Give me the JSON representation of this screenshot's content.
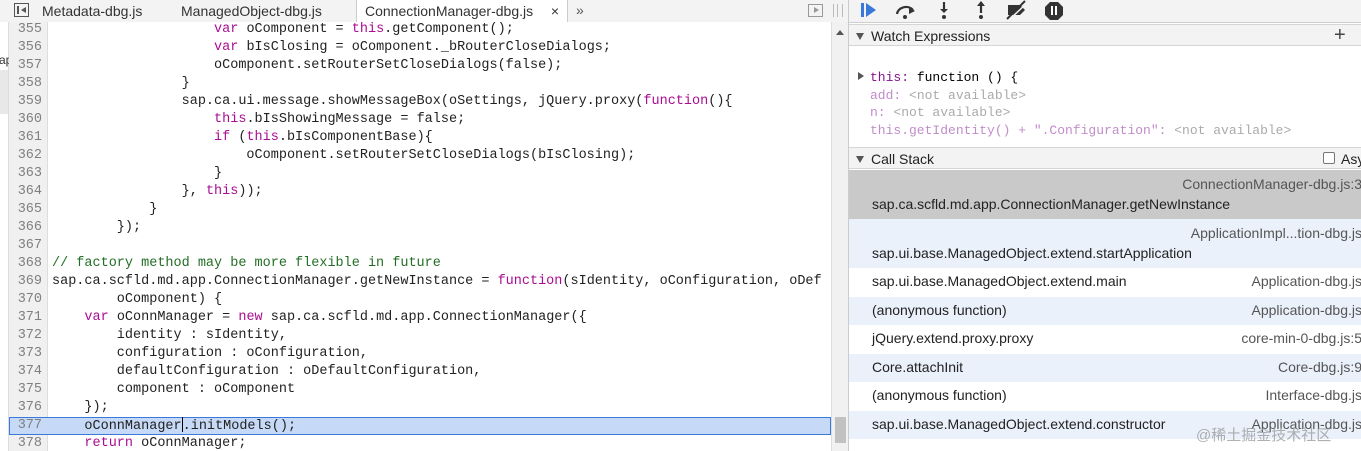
{
  "tabs": [
    {
      "label": "Metadata-dbg.js"
    },
    {
      "label": "ManagedObject-dbg.js"
    },
    {
      "label": "ConnectionManager-dbg.js",
      "close": "×"
    }
  ],
  "tab_overflow": "»",
  "left_strip_text": "ap",
  "code_lines": [
    {
      "n": "355",
      "parts": [
        [
          "",
          "                    "
        ],
        [
          "kw",
          "var"
        ],
        [
          "",
          " oComponent = "
        ],
        [
          "kw",
          "this"
        ],
        [
          "",
          ".getComponent();"
        ]
      ]
    },
    {
      "n": "356",
      "parts": [
        [
          "",
          "                    "
        ],
        [
          "kw",
          "var"
        ],
        [
          "",
          " bIsClosing = oComponent._bRouterCloseDialogs;"
        ]
      ]
    },
    {
      "n": "357",
      "parts": [
        [
          "",
          "                    oComponent.setRouterSetCloseDialogs(false);"
        ]
      ]
    },
    {
      "n": "358",
      "parts": [
        [
          "",
          "                }"
        ]
      ]
    },
    {
      "n": "359",
      "parts": [
        [
          "",
          "                sap.ca.ui.message.showMessageBox(oSettings, jQuery.proxy("
        ],
        [
          "kw",
          "function"
        ],
        [
          "",
          "(){"
        ]
      ]
    },
    {
      "n": "360",
      "parts": [
        [
          "",
          "                    "
        ],
        [
          "kw",
          "this"
        ],
        [
          "",
          ".bIsShowingMessage = false;"
        ]
      ]
    },
    {
      "n": "361",
      "parts": [
        [
          "",
          "                    "
        ],
        [
          "kw",
          "if"
        ],
        [
          "",
          " ("
        ],
        [
          "kw",
          "this"
        ],
        [
          "",
          ".bIsComponentBase){"
        ]
      ]
    },
    {
      "n": "362",
      "parts": [
        [
          "",
          "                        oComponent.setRouterSetCloseDialogs(bIsClosing);"
        ]
      ]
    },
    {
      "n": "363",
      "parts": [
        [
          "",
          "                    }"
        ]
      ]
    },
    {
      "n": "364",
      "parts": [
        [
          "",
          "                }, "
        ],
        [
          "kw",
          "this"
        ],
        [
          "",
          "));"
        ]
      ]
    },
    {
      "n": "365",
      "parts": [
        [
          "",
          "            }"
        ]
      ]
    },
    {
      "n": "366",
      "parts": [
        [
          "",
          "        });"
        ]
      ]
    },
    {
      "n": "367",
      "parts": [
        [
          "",
          ""
        ]
      ]
    },
    {
      "n": "368",
      "parts": [
        [
          "cm",
          "// factory method may be more flexible in future"
        ]
      ]
    },
    {
      "n": "369",
      "parts": [
        [
          "",
          "sap.ca.scfld.md.app.ConnectionManager.getNewInstance = "
        ],
        [
          "kw",
          "function"
        ],
        [
          "",
          "(sIdentity, oConfiguration, oDef"
        ]
      ]
    },
    {
      "n": "370",
      "parts": [
        [
          "",
          "        oComponent) {"
        ]
      ]
    },
    {
      "n": "371",
      "parts": [
        [
          "",
          "    "
        ],
        [
          "kw",
          "var"
        ],
        [
          "",
          " oConnManager = "
        ],
        [
          "kw",
          "new"
        ],
        [
          "",
          " sap.ca.scfld.md.app.ConnectionManager({"
        ]
      ]
    },
    {
      "n": "372",
      "parts": [
        [
          "",
          "        identity : sIdentity,"
        ]
      ]
    },
    {
      "n": "373",
      "parts": [
        [
          "",
          "        configuration : oConfiguration,"
        ]
      ]
    },
    {
      "n": "374",
      "parts": [
        [
          "",
          "        defaultConfiguration : oDefaultConfiguration,"
        ]
      ]
    },
    {
      "n": "375",
      "parts": [
        [
          "",
          "        component : oComponent"
        ]
      ]
    },
    {
      "n": "376",
      "parts": [
        [
          "",
          "    });"
        ]
      ]
    },
    {
      "n": "377",
      "hl": true,
      "parts": [
        [
          "",
          "    oConnManager"
        ],
        [
          "caret",
          ""
        ],
        [
          "",
          ".initModels();"
        ]
      ]
    },
    {
      "n": "378",
      "parts": [
        [
          "",
          "    "
        ],
        [
          "kw",
          "return"
        ],
        [
          "",
          " oConnManager;"
        ]
      ]
    }
  ],
  "watch": {
    "header": "Watch Expressions",
    "add": "+",
    "root_name": "this:",
    "root_value": " function () {",
    "props": [
      {
        "name": "add:",
        "value": " <not available>"
      },
      {
        "name": "n:",
        "value": " <not available>"
      },
      {
        "name": "this.getIdentity() + \".Configuration\":",
        "value": " <not available>"
      }
    ]
  },
  "callstack": {
    "header": "Call Stack",
    "async_label": "Asy",
    "frames": [
      {
        "fn": "sap.ca.scfld.md.app.ConnectionManager.getNewInstance",
        "loc": "ConnectionManager-dbg.js:3",
        "selected": true,
        "two_line": true
      },
      {
        "fn": "sap.ui.base.ManagedObject.extend.startApplication",
        "loc": "ApplicationImpl...tion-dbg.js",
        "alt": true,
        "two_line": true
      },
      {
        "fn": "sap.ui.base.ManagedObject.extend.main",
        "loc": "Application-dbg.js"
      },
      {
        "fn": "(anonymous function)",
        "loc": "Application-dbg.js",
        "alt": true
      },
      {
        "fn": "jQuery.extend.proxy.proxy",
        "loc": "core-min-0-dbg.js:5"
      },
      {
        "fn": "Core.attachInit",
        "loc": "Core-dbg.js:9",
        "alt": true
      },
      {
        "fn": "(anonymous function)",
        "loc": "Interface-dbg.js"
      },
      {
        "fn": "sap.ui.base.ManagedObject.extend.constructor",
        "loc": "Application-dbg.js",
        "alt": true
      }
    ]
  },
  "watermark": "@稀土掘金技术社区"
}
